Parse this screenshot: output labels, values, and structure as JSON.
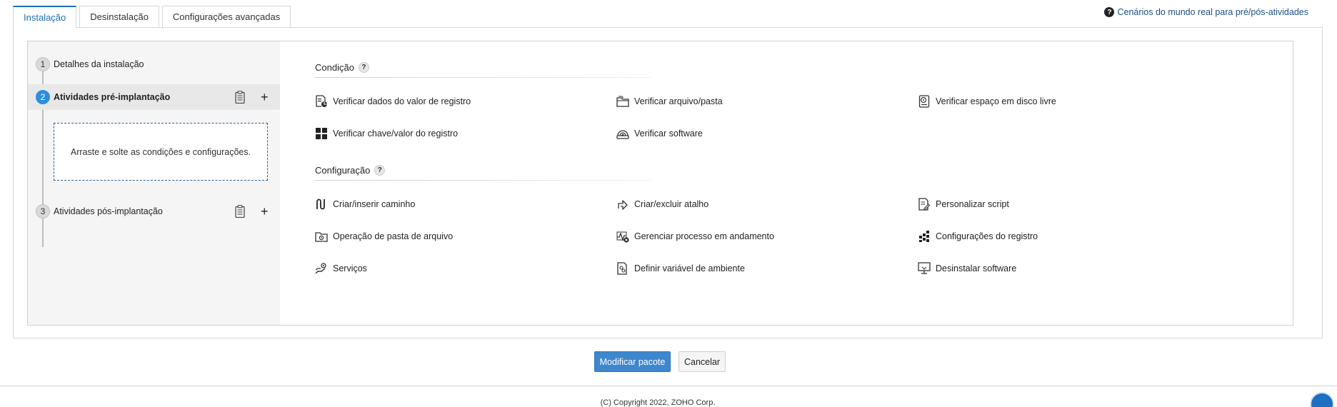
{
  "tabs": [
    {
      "label": "Instalação",
      "active": true
    },
    {
      "label": "Desinstalação",
      "active": false
    },
    {
      "label": "Configurações avançadas",
      "active": false
    }
  ],
  "help_link": "Cenários do mundo real para pré/pós-atividades",
  "steps": [
    {
      "num": "1",
      "label": "Detalhes da instalação"
    },
    {
      "num": "2",
      "label": "Atividades pré-implantação"
    },
    {
      "num": "3",
      "label": "Atividades pós-implantação"
    }
  ],
  "dropzone_text": "Arraste e solte as condições e configurações.",
  "condition": {
    "title": "Condição",
    "help": "?",
    "items": [
      {
        "label": "Verificar dados do valor de registro",
        "icon": "registry-data-icon"
      },
      {
        "label": "Verificar arquivo/pasta",
        "icon": "folder-icon"
      },
      {
        "label": "Verificar espaço em disco livre",
        "icon": "disk-icon"
      },
      {
        "label": "Verificar chave/valor do registro",
        "icon": "registry-key-icon"
      },
      {
        "label": "Verificar software",
        "icon": "software-icon"
      }
    ]
  },
  "configuration": {
    "title": "Configuração",
    "help": "?",
    "items": [
      {
        "label": "Criar/inserir caminho",
        "icon": "path-icon"
      },
      {
        "label": "Criar/excluir atalho",
        "icon": "shortcut-icon"
      },
      {
        "label": "Personalizar script",
        "icon": "script-icon"
      },
      {
        "label": "Operação de pasta de arquivo",
        "icon": "folder-operation-icon"
      },
      {
        "label": "Gerenciar processo em andamento",
        "icon": "process-icon"
      },
      {
        "label": "Configurações do registro",
        "icon": "registry-settings-icon"
      },
      {
        "label": "Serviços",
        "icon": "services-icon"
      },
      {
        "label": "Definir variável de ambiente",
        "icon": "env-variable-icon"
      },
      {
        "label": "Desinstalar software",
        "icon": "uninstall-icon"
      }
    ]
  },
  "buttons": {
    "primary": "Modificar pacote",
    "secondary": "Cancelar"
  },
  "footer": "(C) Copyright 2022, ZOHO Corp."
}
